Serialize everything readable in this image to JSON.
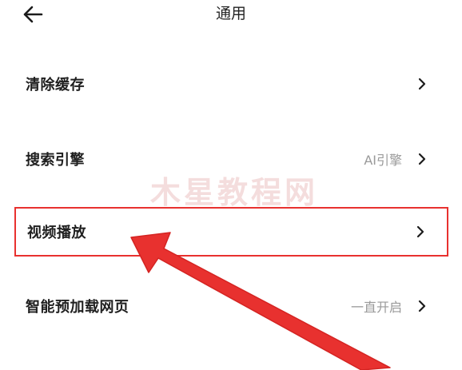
{
  "header": {
    "title": "通用",
    "back_icon": "arrow-left-icon"
  },
  "settings": [
    {
      "label": "清除缓存",
      "value": ""
    },
    {
      "label": "搜索引擎",
      "value": "AI引擎"
    },
    {
      "label": "视频播放",
      "value": ""
    },
    {
      "label": "智能预加载网页",
      "value": "一直开启"
    }
  ],
  "icons": {
    "chevron": "chevron-right-icon"
  },
  "watermark": "木星教程网",
  "colors": {
    "highlight": "#e8312f",
    "arrow": "#e8312f",
    "value_text": "#9a9a9a"
  }
}
